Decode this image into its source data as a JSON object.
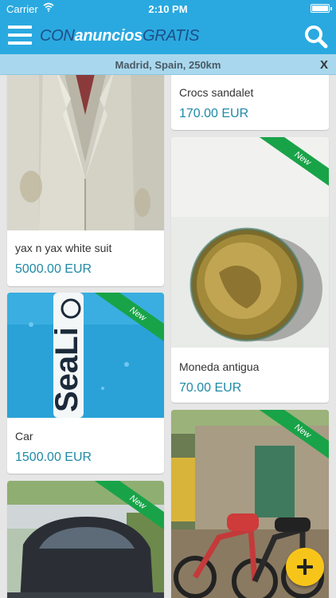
{
  "status_bar": {
    "carrier": "Carrier",
    "time": "2:10 PM"
  },
  "header": {
    "logo": {
      "part1": "CON",
      "part2": "anuncios",
      "part3": "GRATIS"
    },
    "menu_icon": "hamburger-menu-icon",
    "search_icon": "search-icon"
  },
  "location_bar": {
    "location": "Madrid, Spain, 250km",
    "close_label": "X"
  },
  "badge_label": "New",
  "listings": [
    {
      "title": "yax n yax white suit",
      "price": "5000.00 EUR",
      "is_new": false
    },
    {
      "title": "Crocs sandalet",
      "price": "170.00 EUR",
      "is_new": false
    },
    {
      "title": "Moneda antigua",
      "price": "70.00 EUR",
      "is_new": true
    },
    {
      "title": "Car",
      "price": "1500.00 EUR",
      "is_new": true
    },
    {
      "title": "",
      "price": "",
      "is_new": true
    },
    {
      "title": "",
      "price": "",
      "is_new": true
    }
  ],
  "colors": {
    "header_blue": "#2aa9e0",
    "price_teal": "#1f8aa6",
    "new_ribbon_green": "#19a348",
    "fab_yellow": "#f7c51a"
  },
  "fab_icon": "plus-icon"
}
